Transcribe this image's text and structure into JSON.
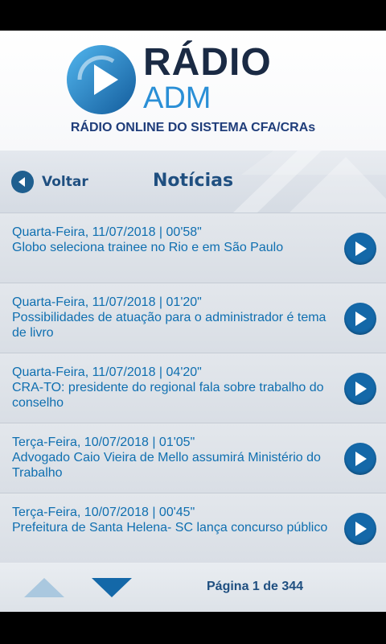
{
  "brand": {
    "radio": "RÁDIO",
    "adm": "ADM",
    "tagline": "RÁDIO ONLINE DO SISTEMA CFA/CRAs"
  },
  "nav": {
    "back_label": "Voltar",
    "page_title": "Notícias"
  },
  "news": [
    {
      "date": "Quarta-Feira, 11/07/2018 | 00'58\"",
      "title": "Globo seleciona trainee no Rio e em São Paulo"
    },
    {
      "date": "Quarta-Feira, 11/07/2018 | 01'20\"",
      "title": "Possibilidades de atuação para o administrador é tema de livro"
    },
    {
      "date": "Quarta-Feira, 11/07/2018 | 04'20\"",
      "title": "CRA-TO: presidente do regional fala sobre trabalho do conselho"
    },
    {
      "date": "Terça-Feira, 10/07/2018 | 01'05\"",
      "title": "Advogado Caio Vieira de Mello assumirá Ministério do Trabalho"
    },
    {
      "date": "Terça-Feira, 10/07/2018 | 00'45\"",
      "title": "Prefeitura de Santa Helena- SC lança concurso público"
    }
  ],
  "pagination": {
    "label": "Página 1 de 344"
  },
  "colors": {
    "accent": "#0f6fb0",
    "heading": "#1f4f80",
    "play_button": "#1468a8"
  }
}
